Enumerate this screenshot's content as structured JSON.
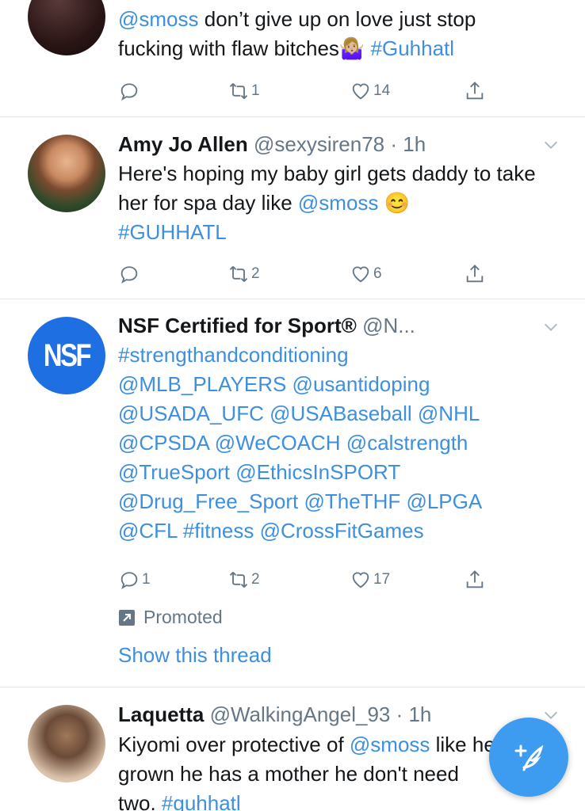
{
  "tweets": [
    {
      "name": "",
      "handle": "",
      "time": "",
      "body_parts": [
        {
          "text": "@smoss",
          "link": true
        },
        {
          "text": " don’t give up on love just stop fucking with flaw bitches",
          "link": false
        },
        {
          "text": "🤷🏼‍♀️",
          "link": false
        },
        {
          "text": " ",
          "link": false
        },
        {
          "text": "#Guhhatl",
          "link": true
        }
      ],
      "replies": "",
      "retweets": "1",
      "likes": "14"
    },
    {
      "name": "Amy Jo Allen",
      "handle": "@sexysiren78",
      "time": "· 1h",
      "body_parts": [
        {
          "text": "Here's hoping my baby girl gets daddy to take her for spa day like ",
          "link": false
        },
        {
          "text": "@smoss",
          "link": true
        },
        {
          "text": " 😊",
          "link": false
        },
        {
          "text": " ",
          "link": false
        },
        {
          "text": "#GUHHATL",
          "link": true
        }
      ],
      "replies": "",
      "retweets": "2",
      "likes": "6"
    },
    {
      "name": "NSF Certified for Sport®",
      "handle": "@N...",
      "time": "",
      "avatar_text": "NSF",
      "body_parts": [
        {
          "text": "#strengthandconditioning @MLB_PLAYERS @usantidoping @USADA_UFC @USABaseball @NHL @CPSDA  @WeCOACH @calstrength @TrueSport @EthicsInSPORT @Drug_Free_Sport @TheTHF @LPGA @CFL #fitness @CrossFitGames",
          "link": true
        }
      ],
      "replies": "1",
      "retweets": "2",
      "likes": "17",
      "promoted_label": "Promoted",
      "thread_label": "Show this thread"
    },
    {
      "name": "Laquetta",
      "handle": "@WalkingAngel_93",
      "time": "· 1h",
      "body_parts": [
        {
          "text": "Kiyomi over protective of ",
          "link": false
        },
        {
          "text": "@smoss",
          "link": true
        },
        {
          "text": " like he grown he has a mother he don't need two. ",
          "link": false
        },
        {
          "text": "#guhhatl",
          "link": true
        }
      ]
    }
  ],
  "icons": {
    "reply": "reply-icon",
    "retweet": "retweet-icon",
    "like": "heart-icon",
    "share": "share-icon",
    "caret": "chevron-down-icon",
    "compose": "compose-tweet-icon",
    "promoted": "promoted-icon"
  },
  "colors": {
    "link": "#3d8fe0",
    "muted": "#657786",
    "fab": "#3d9bf0",
    "nsf_blue": "#1d6fe2"
  }
}
